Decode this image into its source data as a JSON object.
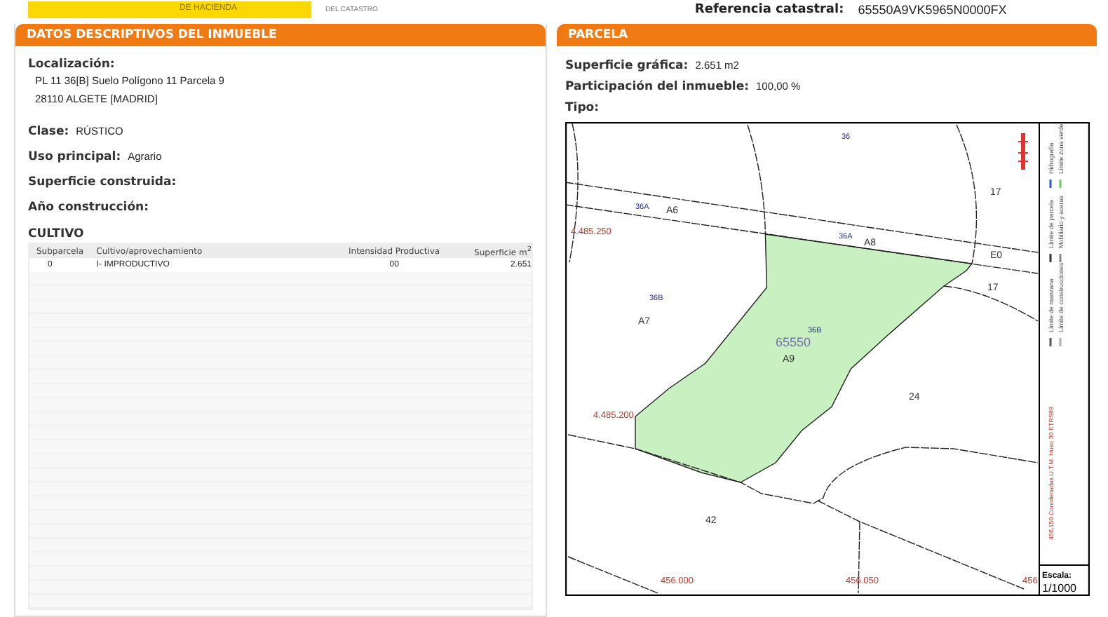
{
  "header": {
    "logo_text": "DE HACIENDA",
    "subtitle": "DEL CATASTRO",
    "reference_label": "Referencia catastral:",
    "reference_value": "65550A9VK5965N0000FX"
  },
  "left_panel": {
    "title": "DATOS DESCRIPTIVOS DEL INMUEBLE",
    "location_label": "Localización:",
    "location_lines": [
      "PL 11 36[B] Suelo Polígono 11 Parcela 9",
      "28110 ALGETE [MADRID]"
    ],
    "fields": [
      {
        "label": "Clase:",
        "value": "RÚSTICO"
      },
      {
        "label": "Uso principal:",
        "value": "Agrario"
      },
      {
        "label": "Superficie construida:"
      },
      {
        "label": "Año construcción:"
      }
    ],
    "section": "CULTIVO",
    "table": {
      "columns": [
        "Subparcela",
        "Cultivo/aprovechamiento",
        "Intensidad Productiva",
        "Superficie m$^{2}$"
      ],
      "rows": [
        [
          "0",
          "I- IMPRODUCTIVO",
          "00",
          "2.651"
        ]
      ]
    }
  },
  "right_panel": {
    "title": "PARCELA",
    "fields": [
      {
        "label": "Superficie gráfica:",
        "value": "2.651 m2"
      },
      {
        "label": "Participación del inmueble:",
        "value": "100,00 %"
      },
      {
        "label": "Tipo:"
      }
    ],
    "map": {
      "labels": [
        {
          "text": "36",
          "kind": "code"
        },
        {
          "text": "36A",
          "kind": "code"
        },
        {
          "text": "A6",
          "kind": "number"
        },
        {
          "text": "4.485.250",
          "kind": "coord"
        },
        {
          "text": "36A",
          "kind": "code"
        },
        {
          "text": "A8",
          "kind": "number"
        },
        {
          "text": "17",
          "kind": "number"
        },
        {
          "text": "E0",
          "kind": "number"
        },
        {
          "text": "17",
          "kind": "number"
        },
        {
          "text": "36B",
          "kind": "code"
        },
        {
          "text": "A7",
          "kind": "number"
        },
        {
          "text": "36B",
          "kind": "code"
        },
        {
          "text": "65550",
          "kind": "parcel"
        },
        {
          "text": "A9",
          "kind": "number"
        },
        {
          "text": "24",
          "kind": "number"
        },
        {
          "text": "4.485.200",
          "kind": "coord"
        },
        {
          "text": "42",
          "kind": "number"
        },
        {
          "text": "456.000",
          "kind": "coord"
        },
        {
          "text": "456.050",
          "kind": "coord"
        },
        {
          "text": "456",
          "kind": "coord"
        }
      ],
      "legend": [
        "Hidrografía",
        "Límite de parcela",
        "Límite de manzana",
        "Límite zona verde",
        "Mobiliario y aceras",
        "Límite de construcciones"
      ],
      "coordinate_note": "456,150 Coordenadas U.T.M. Huso 30 ETRS89",
      "scale_label": "Escala:",
      "scale_value": "1/1000"
    }
  }
}
